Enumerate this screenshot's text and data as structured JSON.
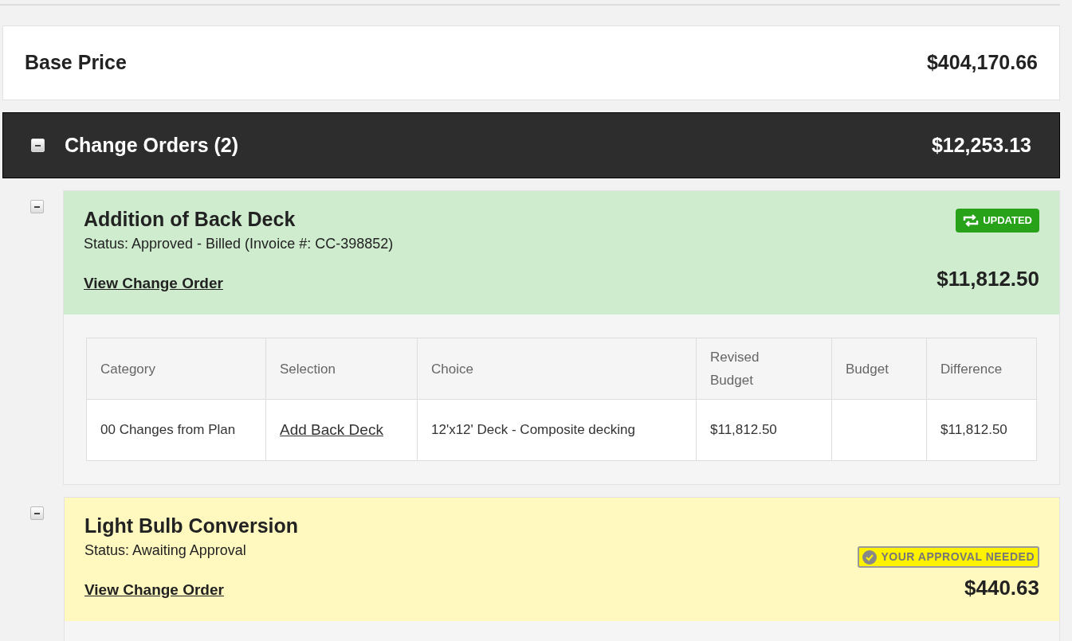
{
  "base_price": {
    "label": "Base Price",
    "amount": "$404,170.66"
  },
  "change_orders": {
    "title": "Change Orders (2)",
    "amount": "$12,253.13",
    "expanded": true,
    "items": [
      {
        "title": "Addition of Back Deck",
        "status": "Status: Approved - Billed (Invoice #: CC-398852)",
        "link": "View Change Order",
        "amount": "$11,812.50",
        "expanded": true,
        "badge": {
          "kind": "updated",
          "label": "UPDATED"
        },
        "color": "#cfecce",
        "table": {
          "columns": [
            "Category",
            "Selection",
            "Choice",
            "Revised Budget",
            "Budget",
            "Difference"
          ],
          "rows": [
            {
              "category": "00 Changes from Plan",
              "selection": "Add Back Deck",
              "choice": "12'x12' Deck - Composite decking",
              "revised_budget": "$11,812.50",
              "difference": "$11,812.50"
            }
          ]
        }
      },
      {
        "title": "Light Bulb Conversion",
        "status": "Status: Awaiting Approval",
        "link": "View Change Order",
        "amount": "$440.63",
        "expanded": true,
        "badge": {
          "kind": "approval",
          "label": "YOUR APPROVAL NEEDED"
        },
        "color": "#fff9c0"
      }
    ]
  }
}
